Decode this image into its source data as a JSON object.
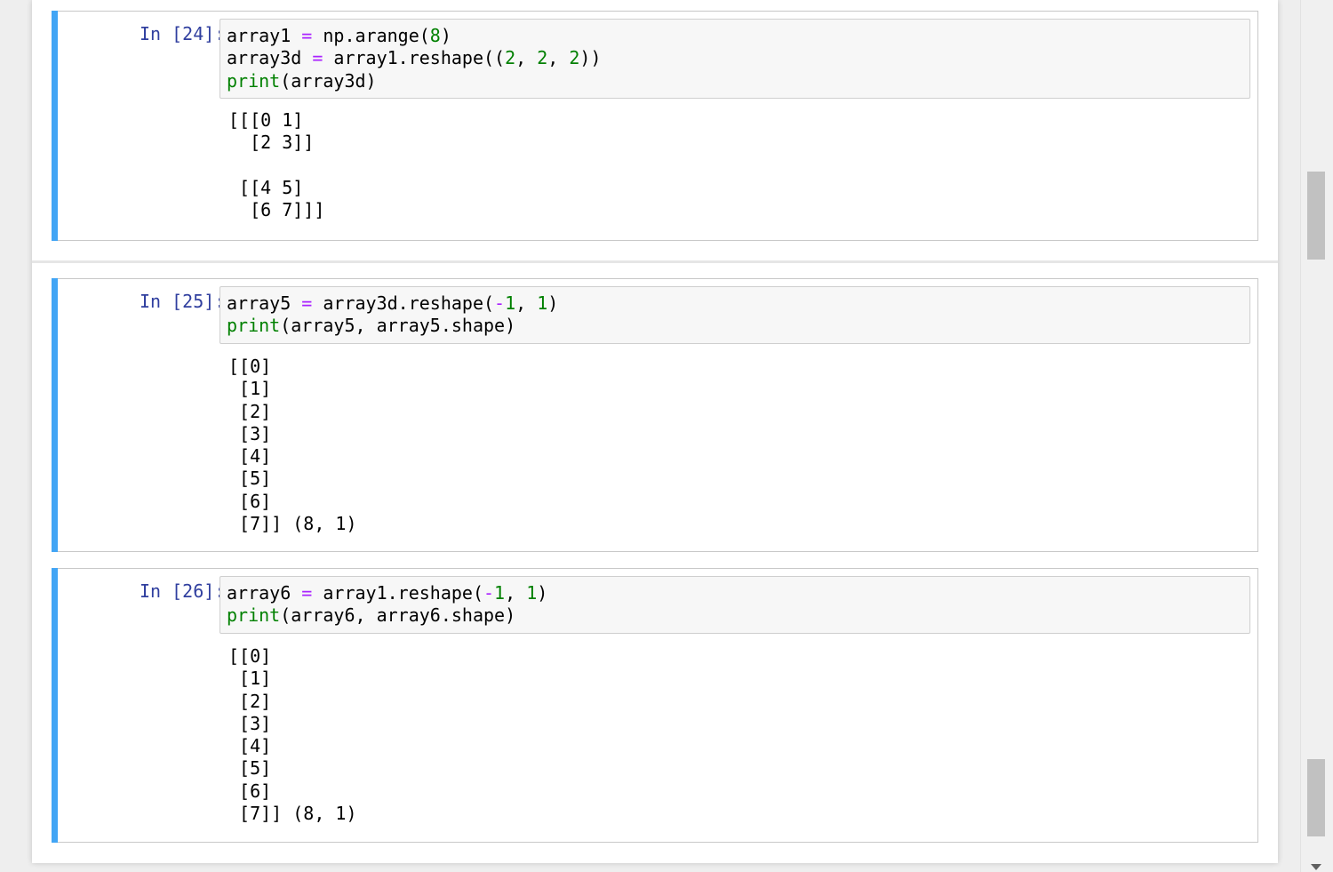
{
  "cells": [
    {
      "prompt": "In [24]:",
      "code": [
        [
          {
            "t": "array1 ",
            "c": ""
          },
          {
            "t": "=",
            "c": "o"
          },
          {
            "t": " np.arange(",
            "c": ""
          },
          {
            "t": "8",
            "c": "n"
          },
          {
            "t": ")",
            "c": ""
          }
        ],
        [
          {
            "t": "array3d ",
            "c": ""
          },
          {
            "t": "=",
            "c": "o"
          },
          {
            "t": " array1.reshape((",
            "c": ""
          },
          {
            "t": "2",
            "c": "n"
          },
          {
            "t": ", ",
            "c": ""
          },
          {
            "t": "2",
            "c": "n"
          },
          {
            "t": ", ",
            "c": ""
          },
          {
            "t": "2",
            "c": "n"
          },
          {
            "t": "))",
            "c": ""
          }
        ],
        [
          {
            "t": "print",
            "c": "k"
          },
          {
            "t": "(array3d)",
            "c": ""
          }
        ]
      ],
      "output": [
        "[[[0 1]",
        "  [2 3]]",
        "",
        " [[4 5]",
        "  [6 7]]]"
      ]
    },
    {
      "prompt": "In [25]:",
      "code": [
        [
          {
            "t": "array5 ",
            "c": ""
          },
          {
            "t": "=",
            "c": "o"
          },
          {
            "t": " array3d.reshape(",
            "c": ""
          },
          {
            "t": "-",
            "c": "o"
          },
          {
            "t": "1",
            "c": "n"
          },
          {
            "t": ", ",
            "c": ""
          },
          {
            "t": "1",
            "c": "n"
          },
          {
            "t": ")",
            "c": ""
          }
        ],
        [
          {
            "t": "print",
            "c": "k"
          },
          {
            "t": "(array5, array5.shape)",
            "c": ""
          }
        ]
      ],
      "output": [
        "[[0]",
        " [1]",
        " [2]",
        " [3]",
        " [4]",
        " [5]",
        " [6]",
        " [7]] (8, 1)"
      ]
    },
    {
      "prompt": "In [26]:",
      "code": [
        [
          {
            "t": "array6 ",
            "c": ""
          },
          {
            "t": "=",
            "c": "o"
          },
          {
            "t": " array1.reshape(",
            "c": ""
          },
          {
            "t": "-",
            "c": "o"
          },
          {
            "t": "1",
            "c": "n"
          },
          {
            "t": ", ",
            "c": ""
          },
          {
            "t": "1",
            "c": "n"
          },
          {
            "t": ")",
            "c": ""
          }
        ],
        [
          {
            "t": "print",
            "c": "k"
          },
          {
            "t": "(array6, array6.shape)",
            "c": ""
          }
        ]
      ],
      "output": [
        "[[0]",
        " [1]",
        " [2]",
        " [3]",
        " [4]",
        " [5]",
        " [6]",
        " [7]] (8, 1)"
      ]
    }
  ],
  "colors": {
    "cell_bar": "#42a5f5",
    "prompt": "#303f9f",
    "keyword": "#008000",
    "operator": "#aa22ff",
    "number": "#008000"
  }
}
